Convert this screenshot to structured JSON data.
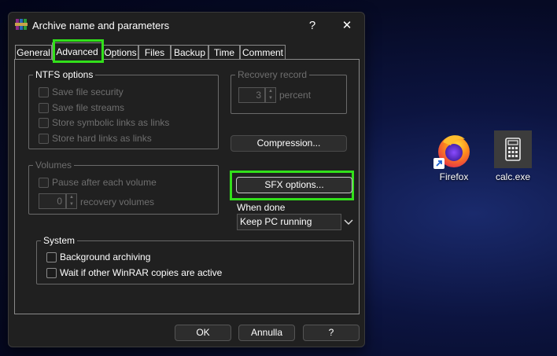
{
  "dialog": {
    "title": "Archive name and parameters",
    "help_label": "?",
    "close_label": "✕",
    "tabs": [
      {
        "label": "General"
      },
      {
        "label": "Advanced"
      },
      {
        "label": "Options"
      },
      {
        "label": "Files"
      },
      {
        "label": "Backup"
      },
      {
        "label": "Time"
      },
      {
        "label": "Comment"
      }
    ],
    "active_tab": "Advanced",
    "ntfs": {
      "title": "NTFS options",
      "save_security": "Save file security",
      "save_streams": "Save file streams",
      "store_symlinks": "Store symbolic links as links",
      "store_hardlinks": "Store hard links as links"
    },
    "recovery": {
      "title": "Recovery record",
      "value": "3",
      "unit": "percent"
    },
    "compression_button": "Compression...",
    "volumes": {
      "title": "Volumes",
      "pause_after": "Pause after each volume",
      "recovery_value": "0",
      "recovery_unit": "recovery volumes"
    },
    "sfx_button": "SFX options...",
    "when_done": {
      "label": "When done",
      "selected": "Keep PC running"
    },
    "system": {
      "title": "System",
      "background": "Background archiving",
      "wait": "Wait if other WinRAR copies are active"
    },
    "ok_label": "OK",
    "cancel_label": "Annulla",
    "help_button_label": "?"
  },
  "desktop": {
    "icons": [
      {
        "label": "Firefox",
        "icon": "firefox-icon"
      },
      {
        "label": "calc.exe",
        "icon": "calculator-icon"
      }
    ]
  },
  "colors": {
    "highlight": "#32e01a",
    "dialog_bg": "#202020"
  }
}
